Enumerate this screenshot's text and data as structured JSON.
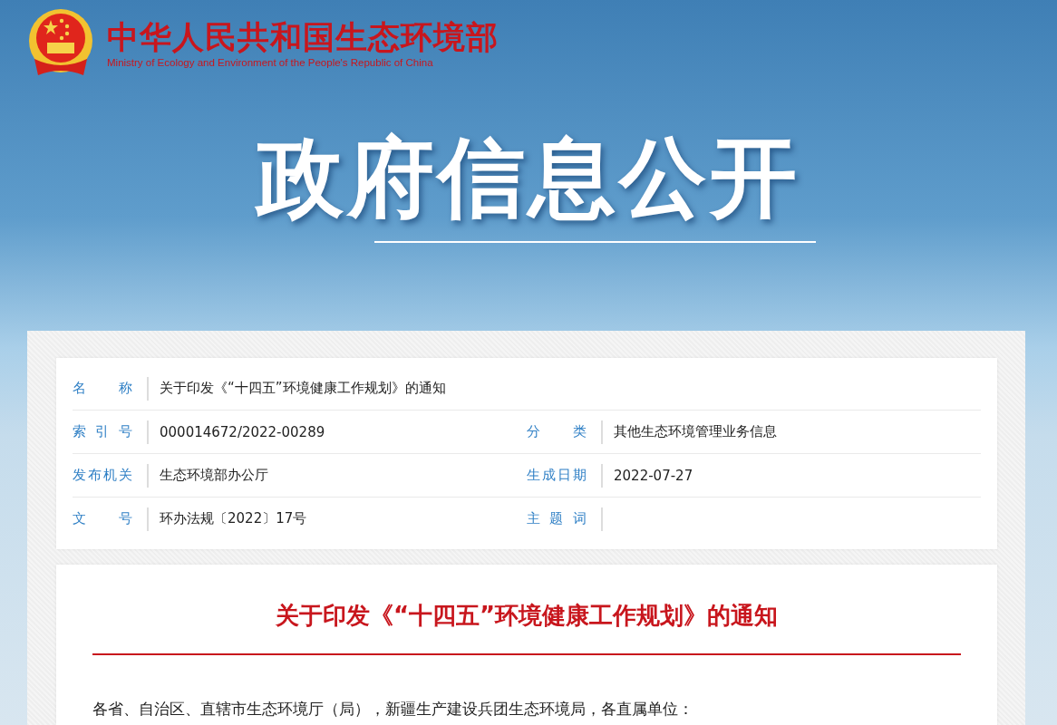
{
  "header": {
    "title": "中华人民共和国生态环境部",
    "subtitle": "Ministry of Ecology and Environment of the People's Republic of China"
  },
  "banner": {
    "title": "政府信息公开"
  },
  "meta": {
    "rows": [
      {
        "cells": [
          {
            "label": "名　　称",
            "value": "关于印发《“十四五”环境健康工作规划》的通知"
          }
        ]
      },
      {
        "cells": [
          {
            "label": "索 引 号",
            "value": "000014672/2022-00289"
          },
          {
            "label": "分　　类",
            "value": "其他生态环境管理业务信息"
          }
        ]
      },
      {
        "cells": [
          {
            "label": "发布机关",
            "value": "生态环境部办公厅"
          },
          {
            "label": "生成日期",
            "value": "2022-07-27"
          }
        ]
      },
      {
        "cells": [
          {
            "label": "文　　号",
            "value": "环办法规〔2022〕17号"
          },
          {
            "label": "主 题 词"
          }
        ]
      }
    ]
  },
  "article": {
    "title": "关于印发《“十四五”环境健康工作规划》的通知",
    "body": "各省、自治区、直辖市生态环境厅（局），新疆生产建设兵团生态环境局，各直属单位："
  }
}
